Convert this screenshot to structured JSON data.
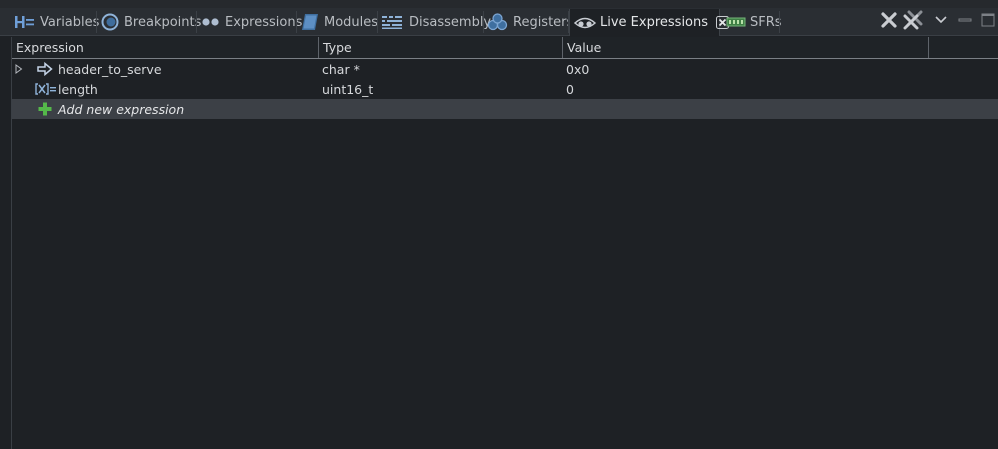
{
  "tabs": [
    {
      "label": "Variables",
      "icon": "variables-icon"
    },
    {
      "label": "Breakpoints",
      "icon": "breakpoints-icon"
    },
    {
      "label": "Expressions",
      "icon": "expressions-icon"
    },
    {
      "label": "Modules",
      "icon": "modules-icon"
    },
    {
      "label": "Disassembly",
      "icon": "disassembly-icon"
    },
    {
      "label": "Registers",
      "icon": "registers-icon"
    },
    {
      "label": "Live Expressions",
      "icon": "live-expressions-icon",
      "active": true
    },
    {
      "label": "SFRs",
      "icon": "sfrs-icon"
    }
  ],
  "toolbar": {
    "remove_icon": "remove-expression-icon",
    "remove_all_icon": "remove-all-expressions-icon",
    "menu_icon": "chevron-down-icon",
    "minimize_icon": "minimize-icon",
    "maximize_icon": "maximize-icon"
  },
  "table": {
    "columns": [
      "Expression",
      "Type",
      "Value"
    ],
    "rows": [
      {
        "expression": "header_to_serve",
        "type": "char *",
        "value": "0x0",
        "expandable": true,
        "icon": "pointer-icon"
      },
      {
        "expression": "length",
        "type": "uint16_t",
        "value": "0",
        "expandable": false,
        "icon": "variable-icon"
      }
    ],
    "add_row": {
      "label": "Add new expression",
      "icon": "add-icon"
    }
  },
  "colors": {
    "background": "#1e2125",
    "tabbar": "#2a2e33",
    "selected_row": "#3c4046",
    "add_icon": "#55b94a",
    "text": "#d6d8db"
  }
}
